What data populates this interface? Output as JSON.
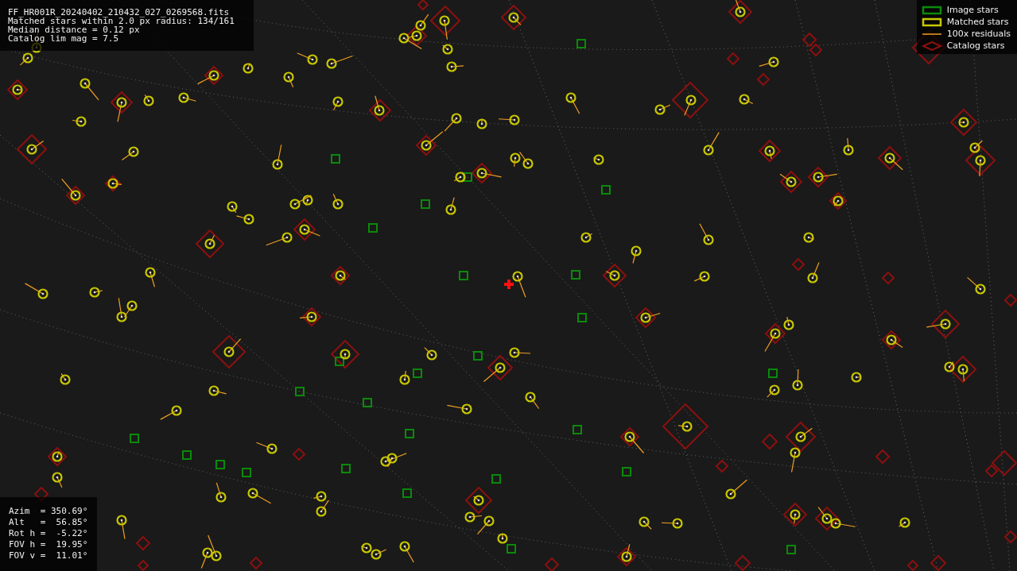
{
  "info_box": {
    "lines": [
      "FF_HR001R_20240402_210432_027_0269568.fits",
      "Matched stars within 2.0 px radius: 134/161",
      "Median distance = 0.12 px",
      "Catalog lim mag = 7.5"
    ]
  },
  "legend": {
    "items": [
      {
        "kind": "image",
        "label": "Image stars"
      },
      {
        "kind": "matched",
        "label": "Matched stars"
      },
      {
        "kind": "residual",
        "label": "100x residuals"
      },
      {
        "kind": "catalog",
        "label": "Catalog stars"
      }
    ]
  },
  "pointing_box": {
    "lines": [
      "Azim  = 350.69°",
      "Alt   =  56.85°",
      "Rot h =  -5.22°",
      "FOV h =  19.95°",
      "FOV v =  11.01°"
    ]
  }
}
